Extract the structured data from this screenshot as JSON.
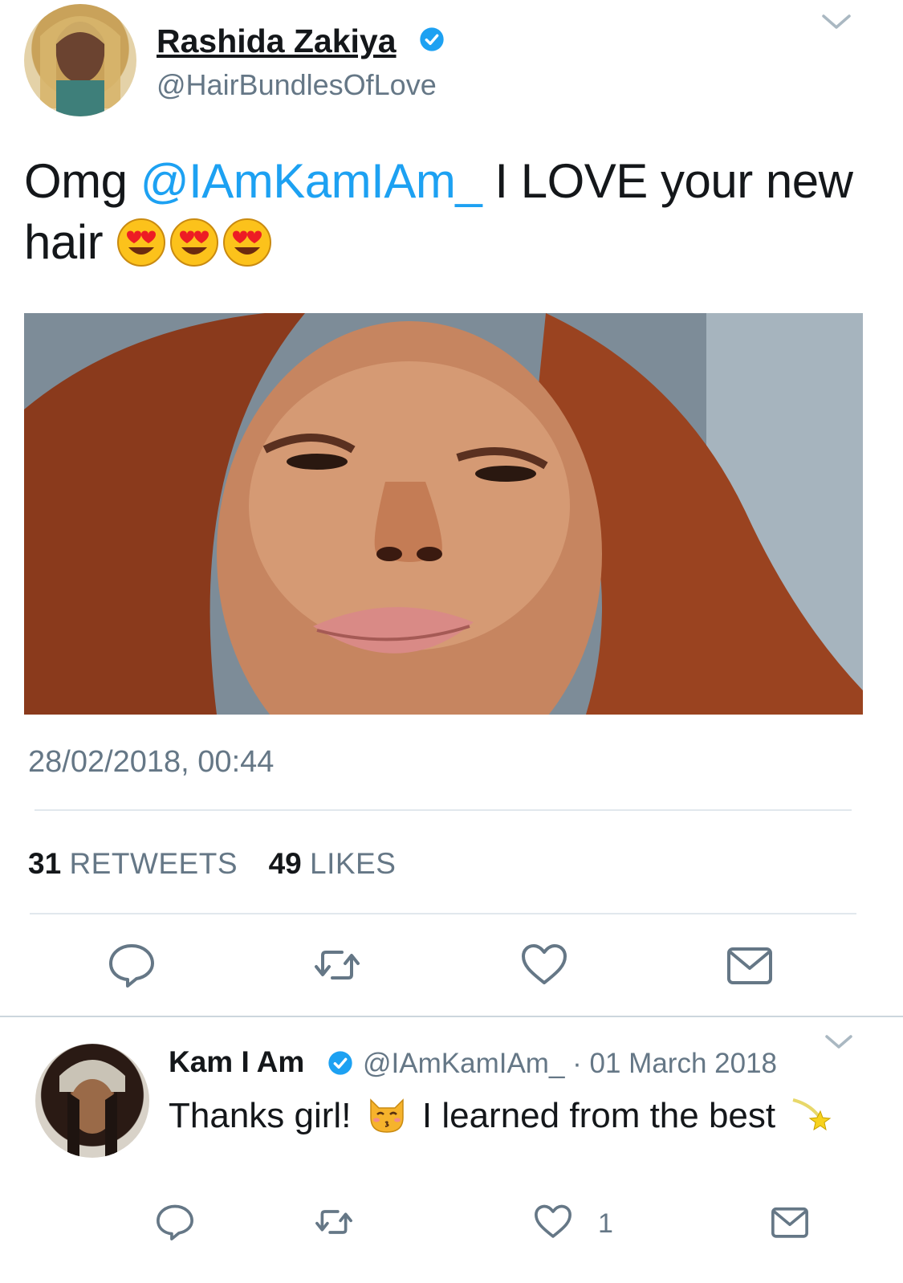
{
  "main_tweet": {
    "author_name": "Rashida Zakiya",
    "author_handle": "@HairBundlesOfLove",
    "text_before": "Omg ",
    "mention": "@IAmKamIAm_",
    "text_after": " I LOVE your new hair",
    "emoji": [
      "heart-eyes",
      "heart-eyes",
      "heart-eyes"
    ],
    "timestamp": "28/02/2018, 00:44",
    "retweet_count": "31",
    "retweet_label": "RETWEETS",
    "like_count": "49",
    "like_label": "LIKES"
  },
  "reply": {
    "author_name": "Kam I Am",
    "author_handle": "@IAmKamIAm_ · 01 March 2018",
    "text_part1": "Thanks girl!",
    "text_part2": "I learned from the best",
    "like_count": "1"
  },
  "colors": {
    "accent": "#1da1f2",
    "secondary_text": "#657786",
    "divider": "#e1e8ed",
    "verified": "#1da1f2"
  },
  "icons": [
    "reply-icon",
    "retweet-icon",
    "like-icon",
    "share-icon",
    "verified-icon",
    "chevron-down-icon"
  ]
}
